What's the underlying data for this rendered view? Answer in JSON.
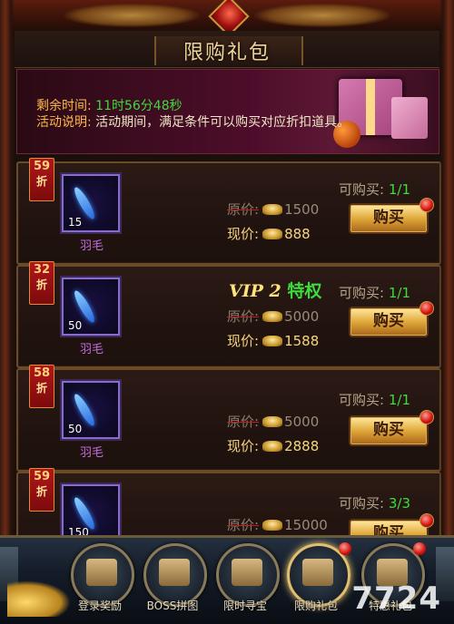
{
  "window": {
    "title": "限购礼包"
  },
  "banner": {
    "time_label": "剩余时间:",
    "time_value": "11时56分48秒",
    "desc_label": "活动说明:",
    "desc_value": "活动期间，满足条件可以购买对应折扣道具。"
  },
  "items": [
    {
      "discount": "59",
      "discount_unit": "折",
      "name": "羽毛",
      "qty": "15",
      "vip": "",
      "orig_label": "原价:",
      "orig_price": "1500",
      "cur_label": "现价:",
      "cur_price": "888",
      "limit_label": "可购买:",
      "limit_value": "1/1",
      "buy_label": "购买"
    },
    {
      "discount": "32",
      "discount_unit": "折",
      "name": "羽毛",
      "qty": "50",
      "vip": {
        "prefix": "VIP 2",
        "suffix": "特权"
      },
      "orig_label": "原价:",
      "orig_price": "5000",
      "cur_label": "现价:",
      "cur_price": "1588",
      "limit_label": "可购买:",
      "limit_value": "1/1",
      "buy_label": "购买"
    },
    {
      "discount": "58",
      "discount_unit": "折",
      "name": "羽毛",
      "qty": "50",
      "vip": "",
      "orig_label": "原价:",
      "orig_price": "5000",
      "cur_label": "现价:",
      "cur_price": "2888",
      "limit_label": "可购买:",
      "limit_value": "1/1",
      "buy_label": "购买"
    },
    {
      "discount": "59",
      "discount_unit": "折",
      "name": "",
      "qty": "150",
      "vip": "",
      "orig_label": "原价:",
      "orig_price": "15000",
      "cur_label": "",
      "cur_price": "",
      "limit_label": "可购买:",
      "limit_value": "3/3",
      "buy_label": "购买"
    }
  ],
  "tabs": [
    {
      "label": "登录奖励",
      "icon": "gift-box-icon"
    },
    {
      "label": "BOSS拼图",
      "icon": "puzzle-icon"
    },
    {
      "label": "限时寻宝",
      "icon": "treasure-chest-icon"
    },
    {
      "label": "限购礼包",
      "icon": "gift-bag-icon",
      "active": true
    },
    {
      "label": "特惠礼包",
      "icon": "gift-pile-icon"
    }
  ],
  "watermark": "7724",
  "colors": {
    "accent_gold": "#f4d27a",
    "green_value": "#3bdc3b",
    "item_name_purple": "#c06ad8"
  }
}
